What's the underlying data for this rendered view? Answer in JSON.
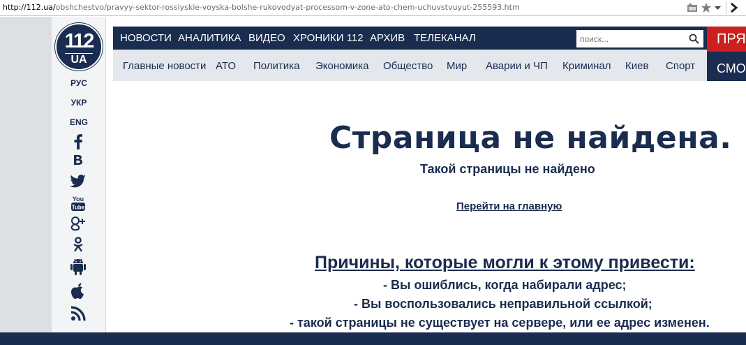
{
  "browser": {
    "url_host": "http://112.ua/",
    "url_path": "obshchestvo/pravyy-sektor-rossiyskie-voyska-bolshe-rukovodyat-processom-v-zone-ato-chem-uchuvstvuyut-255593.htm",
    "icons": [
      "page-icon",
      "star-icon",
      "dropdown-icon",
      "forward-icon"
    ]
  },
  "logo": {
    "number": "112",
    "suffix": "UA"
  },
  "sidebar": {
    "languages": [
      "РУС",
      "УКР",
      "ENG"
    ],
    "social": [
      "facebook-icon",
      "vk-icon",
      "twitter-icon",
      "youtube-icon",
      "googleplus-icon",
      "odnoklassniki-icon",
      "android-icon",
      "apple-icon",
      "rss-icon"
    ],
    "youtube_text_top": "You",
    "youtube_text_bottom": "Tube"
  },
  "topnav": {
    "items": [
      "НОВОСТИ",
      "АНАЛИТИКА",
      "ВИДЕО",
      "ХРОНИКИ 112",
      "АРХИВ",
      "ТЕЛЕКАНАЛ"
    ],
    "search_placeholder": "поиск...",
    "live_top": "ПРЯМ",
    "live_bottom": "СМОТ"
  },
  "subnav": {
    "items": [
      "Главные новости",
      "АТО",
      "Политика",
      "Экономика",
      "Общество",
      "Мир",
      "Аварии и ЧП",
      "Криминал",
      "Киев",
      "Спорт"
    ]
  },
  "content": {
    "title": "Страница не найдена.",
    "subtitle": "Такой страницы не найдено",
    "home_link": "Перейти на главную",
    "reasons_title": "Причины, которые могли к этому привести:",
    "reasons": [
      "- Вы ошиблись, когда набирали адрес;",
      "- Вы воспользовались неправильной ссылкой;",
      "- такой страницы не существует на сервере, или ее адрес изменен."
    ]
  },
  "colors": {
    "brand": "#1a2c4f",
    "live": "#cc1f1f",
    "subnav_bg": "#e4e7ec"
  }
}
